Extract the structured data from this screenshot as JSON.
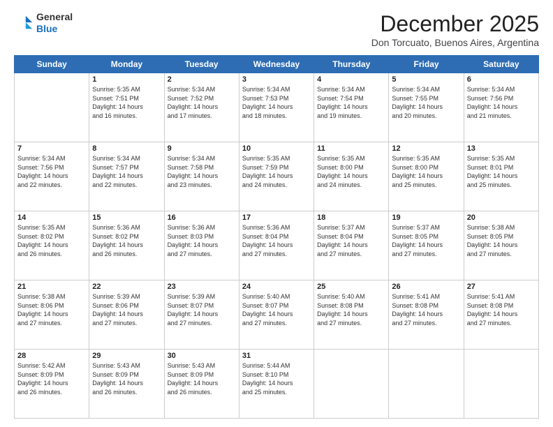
{
  "header": {
    "logo_general": "General",
    "logo_blue": "Blue",
    "month": "December 2025",
    "location": "Don Torcuato, Buenos Aires, Argentina"
  },
  "calendar": {
    "days_of_week": [
      "Sunday",
      "Monday",
      "Tuesday",
      "Wednesday",
      "Thursday",
      "Friday",
      "Saturday"
    ],
    "weeks": [
      [
        {
          "day": "",
          "info": ""
        },
        {
          "day": "1",
          "info": "Sunrise: 5:35 AM\nSunset: 7:51 PM\nDaylight: 14 hours\nand 16 minutes."
        },
        {
          "day": "2",
          "info": "Sunrise: 5:34 AM\nSunset: 7:52 PM\nDaylight: 14 hours\nand 17 minutes."
        },
        {
          "day": "3",
          "info": "Sunrise: 5:34 AM\nSunset: 7:53 PM\nDaylight: 14 hours\nand 18 minutes."
        },
        {
          "day": "4",
          "info": "Sunrise: 5:34 AM\nSunset: 7:54 PM\nDaylight: 14 hours\nand 19 minutes."
        },
        {
          "day": "5",
          "info": "Sunrise: 5:34 AM\nSunset: 7:55 PM\nDaylight: 14 hours\nand 20 minutes."
        },
        {
          "day": "6",
          "info": "Sunrise: 5:34 AM\nSunset: 7:56 PM\nDaylight: 14 hours\nand 21 minutes."
        }
      ],
      [
        {
          "day": "7",
          "info": "Sunrise: 5:34 AM\nSunset: 7:56 PM\nDaylight: 14 hours\nand 22 minutes."
        },
        {
          "day": "8",
          "info": "Sunrise: 5:34 AM\nSunset: 7:57 PM\nDaylight: 14 hours\nand 22 minutes."
        },
        {
          "day": "9",
          "info": "Sunrise: 5:34 AM\nSunset: 7:58 PM\nDaylight: 14 hours\nand 23 minutes."
        },
        {
          "day": "10",
          "info": "Sunrise: 5:35 AM\nSunset: 7:59 PM\nDaylight: 14 hours\nand 24 minutes."
        },
        {
          "day": "11",
          "info": "Sunrise: 5:35 AM\nSunset: 8:00 PM\nDaylight: 14 hours\nand 24 minutes."
        },
        {
          "day": "12",
          "info": "Sunrise: 5:35 AM\nSunset: 8:00 PM\nDaylight: 14 hours\nand 25 minutes."
        },
        {
          "day": "13",
          "info": "Sunrise: 5:35 AM\nSunset: 8:01 PM\nDaylight: 14 hours\nand 25 minutes."
        }
      ],
      [
        {
          "day": "14",
          "info": "Sunrise: 5:35 AM\nSunset: 8:02 PM\nDaylight: 14 hours\nand 26 minutes."
        },
        {
          "day": "15",
          "info": "Sunrise: 5:36 AM\nSunset: 8:02 PM\nDaylight: 14 hours\nand 26 minutes."
        },
        {
          "day": "16",
          "info": "Sunrise: 5:36 AM\nSunset: 8:03 PM\nDaylight: 14 hours\nand 27 minutes."
        },
        {
          "day": "17",
          "info": "Sunrise: 5:36 AM\nSunset: 8:04 PM\nDaylight: 14 hours\nand 27 minutes."
        },
        {
          "day": "18",
          "info": "Sunrise: 5:37 AM\nSunset: 8:04 PM\nDaylight: 14 hours\nand 27 minutes."
        },
        {
          "day": "19",
          "info": "Sunrise: 5:37 AM\nSunset: 8:05 PM\nDaylight: 14 hours\nand 27 minutes."
        },
        {
          "day": "20",
          "info": "Sunrise: 5:38 AM\nSunset: 8:05 PM\nDaylight: 14 hours\nand 27 minutes."
        }
      ],
      [
        {
          "day": "21",
          "info": "Sunrise: 5:38 AM\nSunset: 8:06 PM\nDaylight: 14 hours\nand 27 minutes."
        },
        {
          "day": "22",
          "info": "Sunrise: 5:39 AM\nSunset: 8:06 PM\nDaylight: 14 hours\nand 27 minutes."
        },
        {
          "day": "23",
          "info": "Sunrise: 5:39 AM\nSunset: 8:07 PM\nDaylight: 14 hours\nand 27 minutes."
        },
        {
          "day": "24",
          "info": "Sunrise: 5:40 AM\nSunset: 8:07 PM\nDaylight: 14 hours\nand 27 minutes."
        },
        {
          "day": "25",
          "info": "Sunrise: 5:40 AM\nSunset: 8:08 PM\nDaylight: 14 hours\nand 27 minutes."
        },
        {
          "day": "26",
          "info": "Sunrise: 5:41 AM\nSunset: 8:08 PM\nDaylight: 14 hours\nand 27 minutes."
        },
        {
          "day": "27",
          "info": "Sunrise: 5:41 AM\nSunset: 8:08 PM\nDaylight: 14 hours\nand 27 minutes."
        }
      ],
      [
        {
          "day": "28",
          "info": "Sunrise: 5:42 AM\nSunset: 8:09 PM\nDaylight: 14 hours\nand 26 minutes."
        },
        {
          "day": "29",
          "info": "Sunrise: 5:43 AM\nSunset: 8:09 PM\nDaylight: 14 hours\nand 26 minutes."
        },
        {
          "day": "30",
          "info": "Sunrise: 5:43 AM\nSunset: 8:09 PM\nDaylight: 14 hours\nand 26 minutes."
        },
        {
          "day": "31",
          "info": "Sunrise: 5:44 AM\nSunset: 8:10 PM\nDaylight: 14 hours\nand 25 minutes."
        },
        {
          "day": "",
          "info": ""
        },
        {
          "day": "",
          "info": ""
        },
        {
          "day": "",
          "info": ""
        }
      ]
    ]
  }
}
